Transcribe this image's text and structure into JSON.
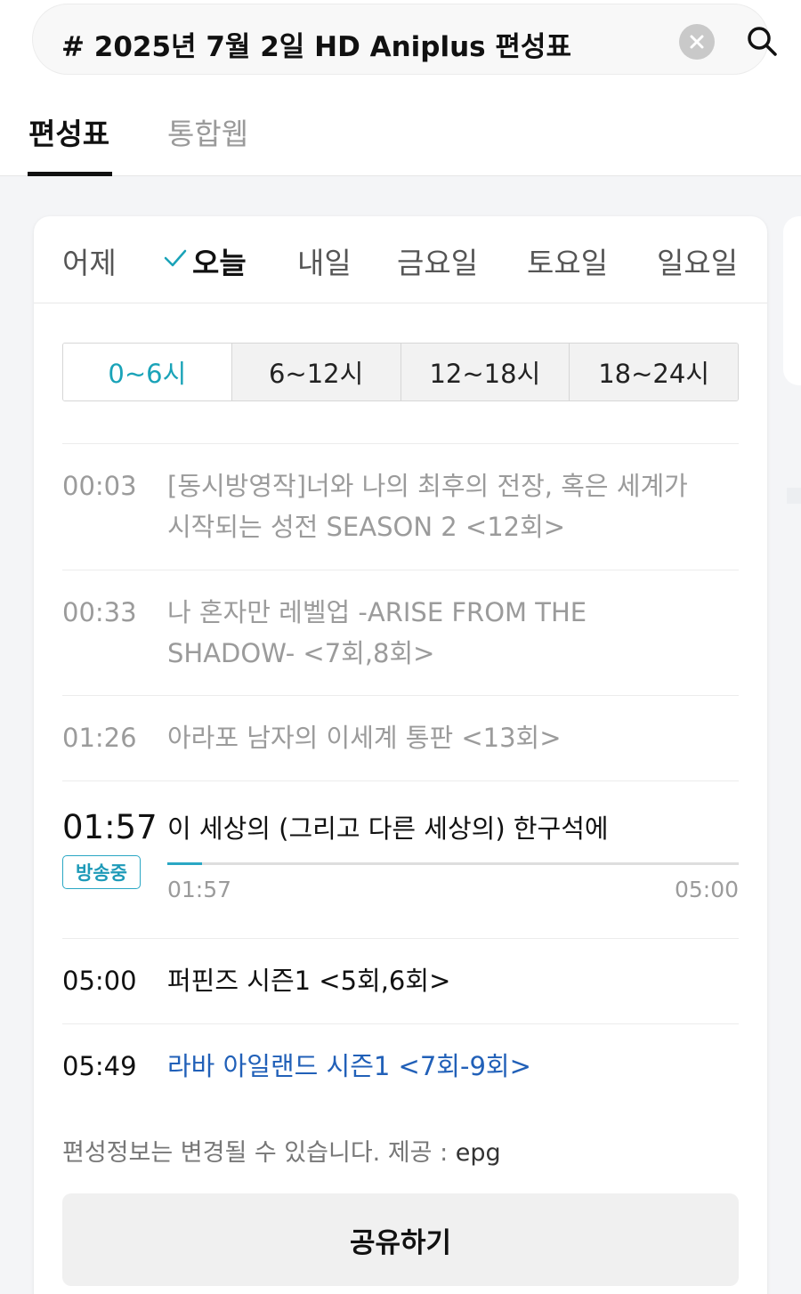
{
  "search": {
    "query": "# 2025년 7월 2일 HD Aniplus 편성표"
  },
  "main_tabs": [
    {
      "label": "편성표",
      "active": true
    },
    {
      "label": "통합웹",
      "active": false
    }
  ],
  "day_tabs": [
    {
      "label": "어제",
      "active": false
    },
    {
      "label": "오늘",
      "active": true
    },
    {
      "label": "내일",
      "active": false
    },
    {
      "label": "금요일",
      "active": false
    },
    {
      "label": "토요일",
      "active": false
    },
    {
      "label": "일요일",
      "active": false
    }
  ],
  "time_slots": [
    {
      "label": "0~6시",
      "active": true
    },
    {
      "label": "6~12시",
      "active": false
    },
    {
      "label": "12~18시",
      "active": false
    },
    {
      "label": "18~24시",
      "active": false
    }
  ],
  "schedule": [
    {
      "time": "00:03",
      "title": "[동시방영작]너와 나의 최후의 전장, 혹은 세계가 시작되는 성전 SEASON 2 <12회>",
      "state": "past"
    },
    {
      "time": "00:33",
      "title": "나 혼자만 레벨업 -ARISE FROM THE SHADOW- <7회,8회>",
      "state": "past"
    },
    {
      "time": "01:26",
      "title": "아라포 남자의 이세계 통판 <13회>",
      "state": "past"
    },
    {
      "time": "01:57",
      "title": "이 세상의 (그리고 다른 세상의) 한구석에",
      "state": "now",
      "badge": "방송중",
      "progress_start": "01:57",
      "progress_end": "05:00",
      "progress_fraction": 0.06
    },
    {
      "time": "05:00",
      "title": "퍼핀즈 시즌1 <5회,6회>",
      "state": "future"
    },
    {
      "time": "05:49",
      "title": "라바 아일랜드 시즌1 <7회-9회>",
      "state": "link"
    }
  ],
  "notice": {
    "text": "편성정보는 변경될 수 있습니다. 제공 : ",
    "source": "epg"
  },
  "share_label": "공유하기",
  "colors": {
    "accent": "#1aa3b8",
    "link": "#2160b8",
    "badge": "#2aa7c4"
  }
}
